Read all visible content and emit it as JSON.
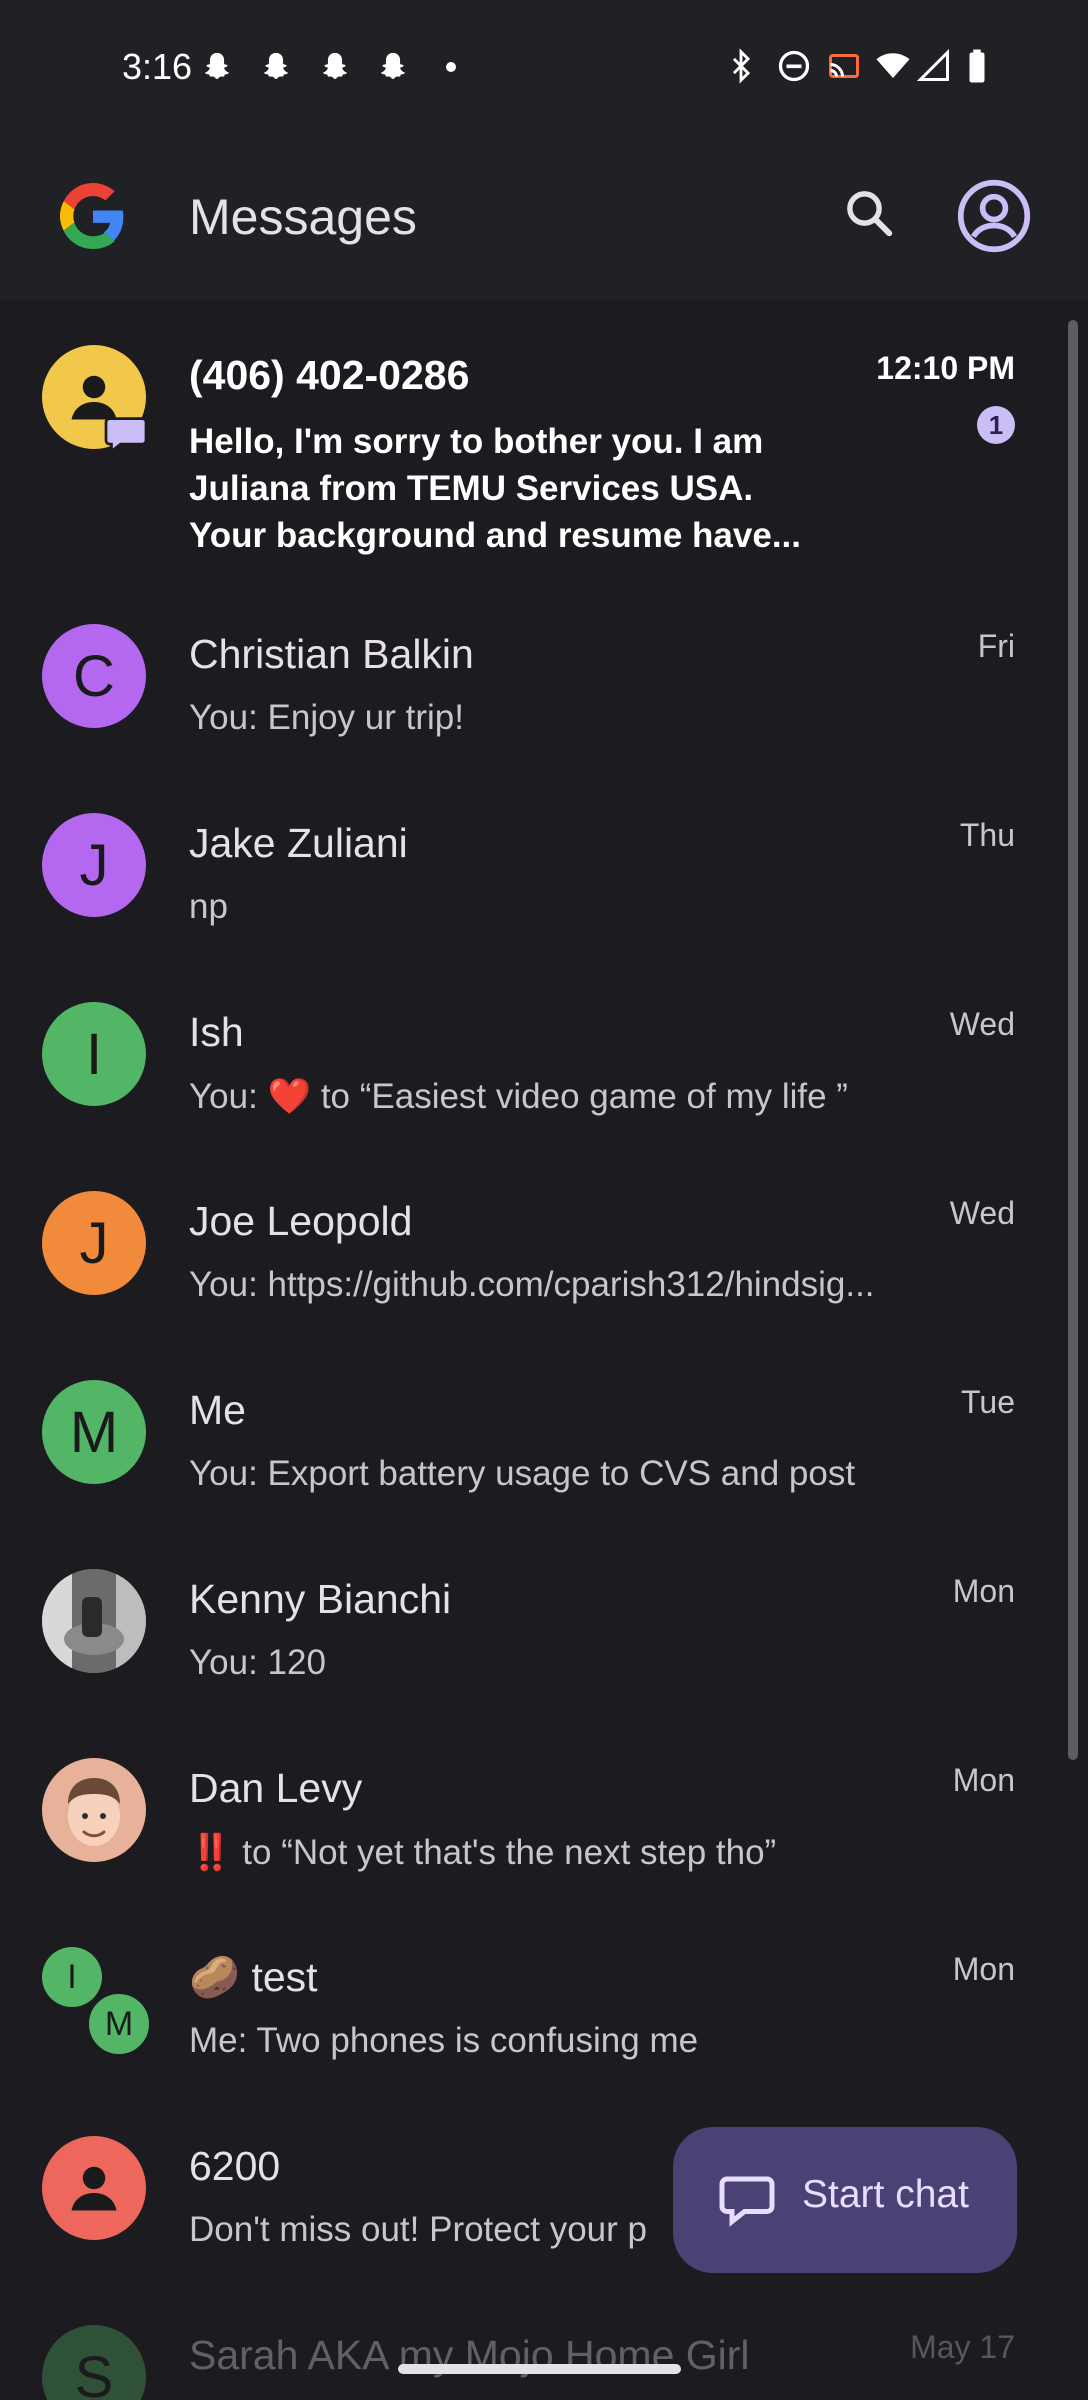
{
  "status_bar": {
    "time": "3:16",
    "icons": [
      "snapchat-icon",
      "snapchat-icon",
      "snapchat-icon",
      "snapchat-icon",
      "dot-icon",
      "bluetooth-icon",
      "do-not-disturb-icon",
      "cast-icon",
      "wifi-icon",
      "cellular-icon",
      "battery-icon"
    ]
  },
  "app": {
    "title": "Messages",
    "logo": "google-logo",
    "search_icon": "search-icon",
    "account_icon": "account-icon"
  },
  "conversations": [
    {
      "name": "(406) 402-0286",
      "preview_lines": [
        "Hello, I'm sorry to bother you. I am",
        "Juliana from TEMU Services USA.",
        "Your background and resume have..."
      ],
      "time": "12:10 PM",
      "unread": "1",
      "avatar_color": "#f2c84b",
      "avatar_type": "person"
    },
    {
      "name": "Christian Balkin",
      "preview": "You: Enjoy ur trip!",
      "time": "Fri",
      "avatar_letter": "C",
      "avatar_color": "#b468f0"
    },
    {
      "name": "Jake Zuliani",
      "preview": "np",
      "time": "Thu",
      "avatar_letter": "J",
      "avatar_color": "#b468f0"
    },
    {
      "name": "Ish",
      "preview": "You: ❤️ to “Easiest video game of my life ”",
      "time": "Wed",
      "avatar_letter": "I",
      "avatar_color": "#53b667"
    },
    {
      "name": "Joe Leopold",
      "preview": "You: https://github.com/cparish312/hindsig...",
      "time": "Wed",
      "avatar_letter": "J",
      "avatar_color": "#f28a3c"
    },
    {
      "name": "Me",
      "preview": "You: Export battery usage to CVS and post",
      "time": "Tue",
      "avatar_letter": "M",
      "avatar_color": "#53b667"
    },
    {
      "name": "Kenny Bianchi",
      "preview": "You: 120",
      "time": "Mon",
      "avatar_type": "photo"
    },
    {
      "name": "Dan Levy",
      "preview": "‼️ to “Not yet that's the next step tho”",
      "time": "Mon",
      "avatar_type": "memoji"
    },
    {
      "name": "🥔 test",
      "preview": "Me: Two phones is confusing me",
      "time": "Mon",
      "avatar_type": "group",
      "group_letters": [
        "I",
        "M"
      ]
    },
    {
      "name": "6200",
      "preview": "Don't miss out! Protect your p",
      "time": "",
      "avatar_color": "#ee675c",
      "avatar_type": "person"
    },
    {
      "name": "Sarah AKA my Mojo Home Girl",
      "preview": "",
      "time": "May 17",
      "avatar_color": "#53b667",
      "avatar_letter": "S"
    }
  ],
  "fab": {
    "label": "Start chat",
    "icon": "chat-bubble-icon"
  }
}
